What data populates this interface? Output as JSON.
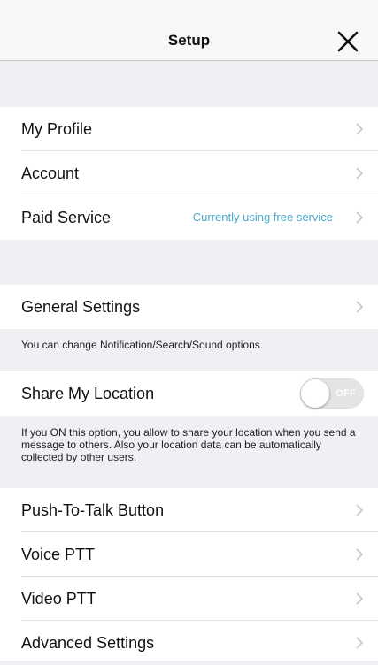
{
  "header": {
    "title": "Setup",
    "close_icon": "close-icon"
  },
  "section1": {
    "items": [
      {
        "label": "My Profile",
        "detail": ""
      },
      {
        "label": "Account",
        "detail": ""
      },
      {
        "label": "Paid Service",
        "detail": "Currently using free service"
      }
    ]
  },
  "general": {
    "label": "General Settings",
    "description": "You can change Notification/Search/Sound options."
  },
  "location": {
    "label": "Share My Location",
    "toggle_text": "OFF",
    "toggle_on": false,
    "description": "If you ON this option, you allow to share your location when you send a message to others. Also your location data can be automatically collected by other users."
  },
  "section3": {
    "items": [
      {
        "label": "Push-To-Talk Button"
      },
      {
        "label": "Voice PTT"
      },
      {
        "label": "Video PTT"
      },
      {
        "label": "Advanced Settings"
      }
    ]
  },
  "colors": {
    "accent_detail": "#4aa9c9",
    "background": "#efeff4",
    "chevron": "#c7c7cc"
  }
}
